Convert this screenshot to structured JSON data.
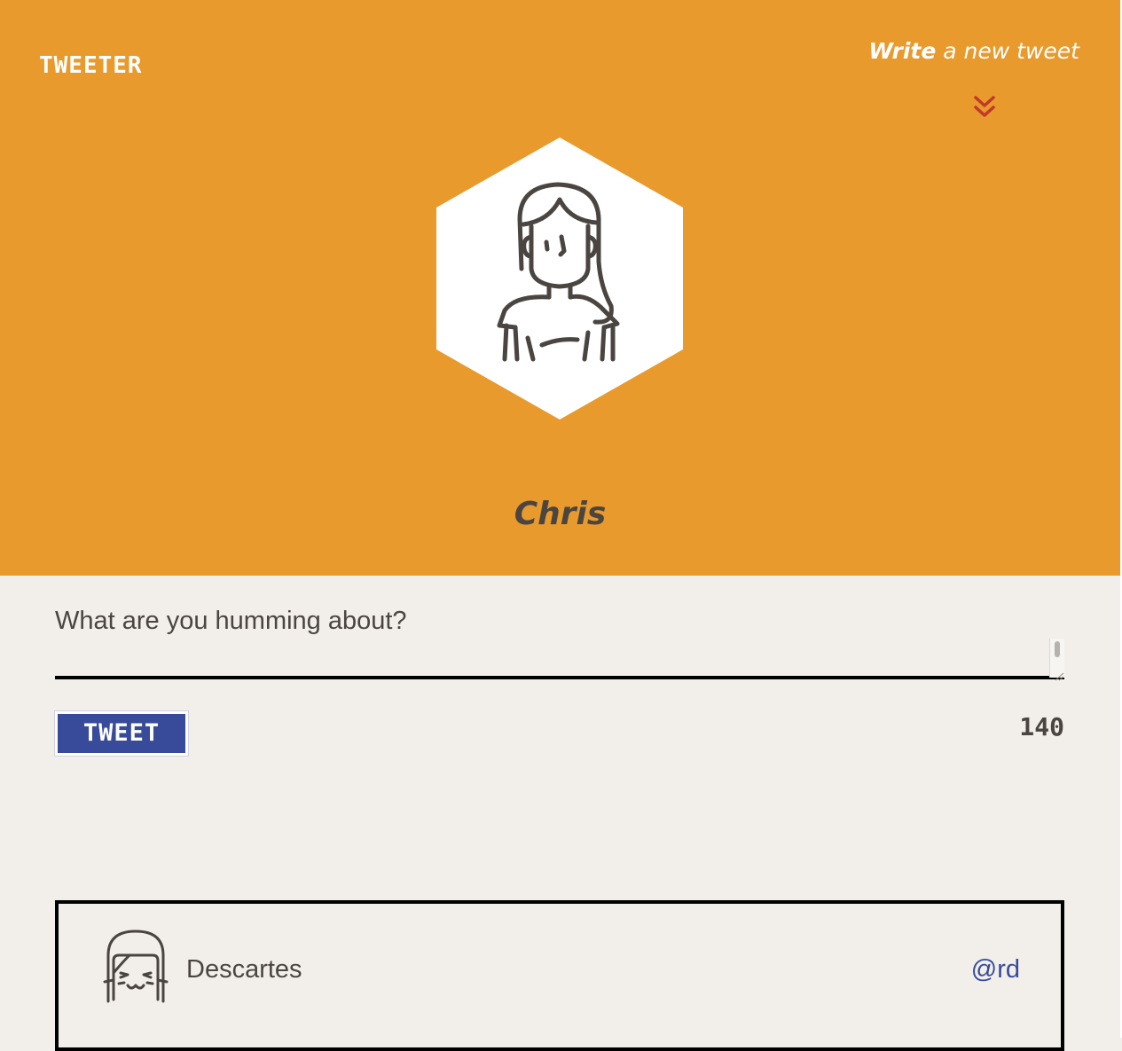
{
  "header": {
    "logo": "TWEETER",
    "write_link": {
      "strong": "Write",
      "rest": " a new tweet"
    },
    "expand_icon": "double-chevron-down-icon",
    "profile_name": "Chris",
    "avatar_icon": "woman-avatar-icon"
  },
  "compose": {
    "placeholder": "What are you humming about?",
    "value": "",
    "button_label": "TWEET",
    "char_counter": "140"
  },
  "feed": [
    {
      "author": "Descartes",
      "handle": "@rd",
      "avatar_icon": "girl-avatar-icon"
    }
  ],
  "colors": {
    "header_bg": "#e89a2c",
    "page_bg": "#f2efea",
    "button_bg": "#374b9a",
    "handle": "#374b9a",
    "chevron": "#c0392b",
    "text_dark": "#4a4540"
  }
}
